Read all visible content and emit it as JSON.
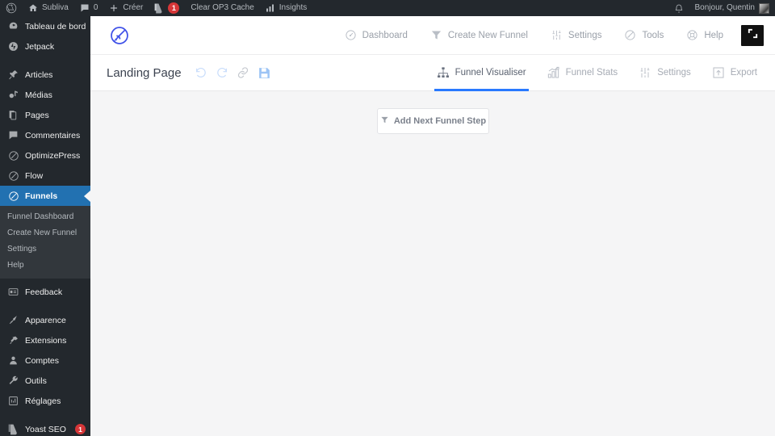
{
  "colors": {
    "adminbar_bg": "#23282d",
    "sidebar_bg": "#23282d",
    "submenu_bg": "#32373c",
    "active_menu": "#2271b1",
    "brand_blue": "#3f51e8",
    "tab_accent": "#2979ff",
    "canvas_bg": "#f5f5f6",
    "badge_red": "#d63638"
  },
  "adminbar": {
    "wp_logo": "wordpress-logo",
    "site_name": "Subliva",
    "comments_count": "0",
    "new_label": "Créer",
    "yoast_badge": "1",
    "clear_cache_label": "Clear OP3 Cache",
    "insights_label": "Insights",
    "greeting": "Bonjour, Quentin"
  },
  "sidebar": {
    "items": [
      {
        "label": "Tableau de bord",
        "icon": "dashboard-icon",
        "active": false
      },
      {
        "label": "Jetpack",
        "icon": "jetpack-icon",
        "active": false
      },
      {
        "label": "Articles",
        "icon": "pin-icon",
        "active": false
      },
      {
        "label": "Médias",
        "icon": "media-icon",
        "active": false
      },
      {
        "label": "Pages",
        "icon": "pages-icon",
        "active": false
      },
      {
        "label": "Commentaires",
        "icon": "comment-icon",
        "active": false
      },
      {
        "label": "OptimizePress",
        "icon": "optimizepress-icon",
        "active": false
      },
      {
        "label": "Flow",
        "icon": "flow-icon",
        "active": false
      },
      {
        "label": "Funnels",
        "icon": "funnels-icon",
        "active": true
      },
      {
        "label": "Feedback",
        "icon": "feedback-icon",
        "active": false
      },
      {
        "label": "Apparence",
        "icon": "appearance-icon",
        "active": false
      },
      {
        "label": "Extensions",
        "icon": "plugins-icon",
        "active": false
      },
      {
        "label": "Comptes",
        "icon": "users-icon",
        "active": false
      },
      {
        "label": "Outils",
        "icon": "tools-icon",
        "active": false
      },
      {
        "label": "Réglages",
        "icon": "settings-icon",
        "active": false
      },
      {
        "label": "Yoast SEO",
        "icon": "yoast-icon",
        "active": false,
        "badge": "1"
      }
    ],
    "submenu": [
      {
        "label": "Funnel Dashboard"
      },
      {
        "label": "Create New Funnel"
      },
      {
        "label": "Settings"
      },
      {
        "label": "Help"
      }
    ]
  },
  "header": {
    "logo": "optimizepress-rocket-logo",
    "nav": [
      {
        "label": "Dashboard",
        "icon": "dashboard-circle-icon"
      },
      {
        "label": "Create New Funnel",
        "icon": "funnel-icon"
      },
      {
        "label": "Settings",
        "icon": "sliders-icon"
      },
      {
        "label": "Tools",
        "icon": "rocket-icon"
      },
      {
        "label": "Help",
        "icon": "lifebuoy-icon"
      }
    ],
    "fullscreen_icon": "fullscreen-expand-icon"
  },
  "subheader": {
    "funnel_title": "Landing Page",
    "tools": [
      {
        "name": "undo-icon",
        "state": "disabled"
      },
      {
        "name": "redo-icon",
        "state": "disabled"
      },
      {
        "name": "link-icon",
        "state": "normal"
      },
      {
        "name": "save-icon",
        "state": "active"
      }
    ],
    "tabs": [
      {
        "label": "Funnel Visualiser",
        "icon": "sitemap-icon",
        "active": true
      },
      {
        "label": "Funnel Stats",
        "icon": "bar-chart-icon",
        "active": false
      },
      {
        "label": "Settings",
        "icon": "sliders-icon",
        "active": false
      },
      {
        "label": "Export",
        "icon": "export-icon",
        "active": false
      }
    ]
  },
  "canvas": {
    "add_step_label": "Add Next Funnel Step",
    "add_step_icon": "funnel-icon"
  }
}
